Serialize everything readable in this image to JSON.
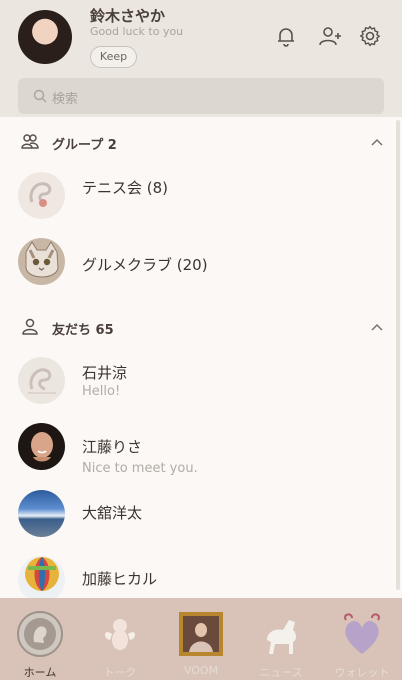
{
  "profile": {
    "name": "鈴木さやか",
    "status": "Good luck to you",
    "keep_label": "Keep"
  },
  "header_icons": [
    "bell-icon",
    "add-friend-icon",
    "gear-icon"
  ],
  "search": {
    "placeholder": "検索"
  },
  "groups": {
    "title": "グループ 2",
    "items": [
      {
        "name": "テニス会 (8)"
      },
      {
        "name": "グルメクラブ (20)"
      }
    ]
  },
  "friends": {
    "title": "友だち 65",
    "items": [
      {
        "name": "石井涼",
        "message": "Hello!"
      },
      {
        "name": "江藤りさ",
        "message": "Nice to meet you."
      },
      {
        "name": "大舘洋太",
        "message": ""
      },
      {
        "name": "加藤ヒカル",
        "message": ""
      }
    ]
  },
  "tabs": [
    {
      "label": "ホーム",
      "active": true
    },
    {
      "label": "トーク",
      "active": false
    },
    {
      "label": "VOOM",
      "active": false
    },
    {
      "label": "ニュース",
      "active": false
    },
    {
      "label": "ウォレット",
      "active": false
    }
  ],
  "colors": {
    "header_bg": "#ebe6e0",
    "list_bg": "#fbf8f5",
    "tabbar_bg": "#d9c3b8"
  }
}
